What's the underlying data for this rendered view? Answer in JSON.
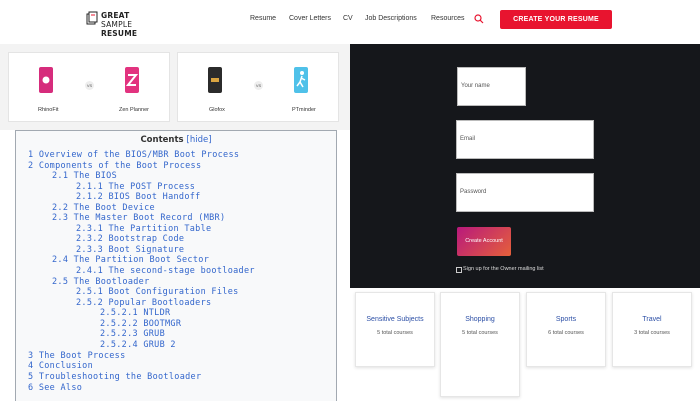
{
  "header": {
    "logo_line1": "GREAT",
    "logo_line2_a": "SAMPLE",
    "logo_line2_b": "RESUME",
    "nav": [
      "Resume",
      "Cover Letters",
      "CV",
      "Job Descriptions",
      "Resources"
    ],
    "cta_label": "CREATE YOUR RESUME"
  },
  "comparisons": [
    {
      "left": "RhinoFit",
      "right": "Zen Planner",
      "vs": "VS"
    },
    {
      "left": "Glofox",
      "right": "PTminder",
      "vs": "VS"
    }
  ],
  "signup": {
    "name_placeholder": "Your name",
    "email_placeholder": "Email",
    "password_placeholder": "Password",
    "create_label": "Create Account",
    "checkbox_label": "Sign up for the Owner mailing list"
  },
  "subjects": [
    {
      "title": "Sensitive Subjects",
      "count": "5 total courses"
    },
    {
      "title": "Shopping",
      "count": "5 total courses"
    },
    {
      "title": "Sports",
      "count": "6 total courses"
    },
    {
      "title": "Travel",
      "count": "3 total courses"
    }
  ],
  "toc": {
    "title": "Contents",
    "hide": "[hide]",
    "items": [
      "1 Overview of the BIOS/MBR Boot Process",
      "2 Components of the Boot Process",
      "2.1  The BIOS",
      "2.1.1 The POST Process",
      "2.1.2 BIOS Boot Handoff",
      "2.2 The Boot Device",
      "2.3 The Master Boot Record (MBR)",
      "2.3.1 The Partition Table",
      "2.3.2 Bootstrap Code",
      "2.3.3 Boot Signature",
      "2.4 The Partition Boot Sector",
      "2.4.1 The second-stage bootloader",
      "2.5 The Bootloader",
      "2.5.1 Boot Configuration Files",
      "2.5.2 Popular Bootloaders",
      "2.5.2.1 NTLDR",
      "2.5.2.2 BOOTMGR",
      "2.5.2.3 GRUB",
      "2.5.2.4 GRUB 2",
      "3 The Boot Process",
      "4 Conclusion",
      "5 Troubleshooting the Bootloader",
      "6 See Also"
    ]
  },
  "colors": {
    "accent": "#e8142f",
    "dark_panel": "#15171b",
    "link": "#3366cc",
    "subject_title": "#2c4fa6"
  },
  "icons": {
    "search": "search-icon",
    "logo": "page-stack-icon"
  }
}
